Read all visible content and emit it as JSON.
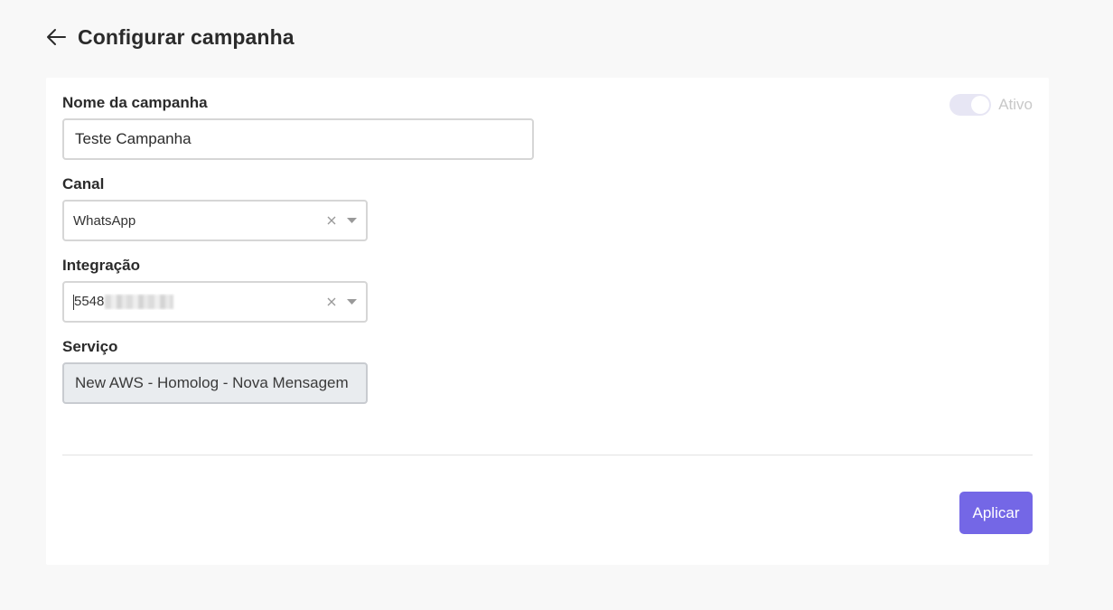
{
  "header": {
    "title": "Configurar campanha",
    "back_icon": "arrow-left-icon"
  },
  "form": {
    "campaign_name": {
      "label": "Nome da campanha",
      "value": "Teste Campanha"
    },
    "channel": {
      "label": "Canal",
      "value": "WhatsApp"
    },
    "integration": {
      "label": "Integração",
      "value_visible": "5548"
    },
    "service": {
      "label": "Serviço",
      "value": "New AWS - Homolog - Nova Mensagem"
    },
    "active_toggle": {
      "label": "Ativo",
      "state": "on-disabled"
    }
  },
  "actions": {
    "apply_label": "Aplicar"
  },
  "colors": {
    "accent": "#7467e6",
    "background": "#f8f8f8",
    "card": "#ffffff"
  }
}
